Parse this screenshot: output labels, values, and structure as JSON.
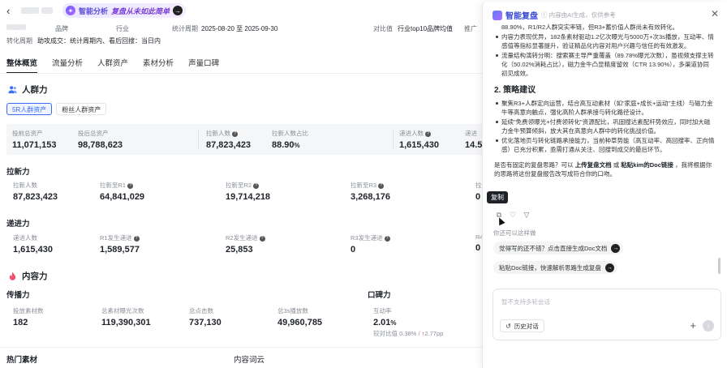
{
  "header": {
    "ai_pill_title": "智能分析",
    "ai_pill_slogan": "复盘从未如此简单"
  },
  "meta": {
    "brand_label": "品牌",
    "industry_label": "行业",
    "period_label": "统计周期",
    "period_value": "2025-08-20 至 2025-09-30",
    "compare_label": "对比值",
    "compare_value": "行业top10品牌均值",
    "promo_label": "推广",
    "conv_period_label": "转化周期",
    "conv_period_value": "助攻成交：统计周期内、看后回搜：当日内"
  },
  "tabs": [
    "整体概览",
    "流量分析",
    "人群资产",
    "素材分析",
    "声量口碑"
  ],
  "crowd": {
    "title": "人群力",
    "chips": [
      "5R人群资产",
      "粉丝人群资产"
    ],
    "summary": [
      {
        "label": "投前总资产",
        "value": "11,071,153"
      },
      {
        "label": "投后总资产",
        "value": "98,788,623"
      },
      {
        "label": "拉新人数",
        "value": "87,823,423"
      },
      {
        "label": "拉新人数占比",
        "value": "88.90",
        "unit": "%"
      },
      {
        "label": "递进人数",
        "value": "1,615,430"
      },
      {
        "label": "递进",
        "value": "14.5"
      }
    ],
    "pull_title": "拉新力",
    "pull": [
      {
        "label": "拉新人数",
        "value": "87,823,423"
      },
      {
        "label": "拉新至R1",
        "value": "64,841,029"
      },
      {
        "label": "拉新至R2",
        "value": "19,714,218"
      },
      {
        "label": "拉新至R3",
        "value": "3,268,176"
      },
      {
        "label": "拉",
        "value": "0"
      }
    ],
    "push_title": "递进力",
    "push": [
      {
        "label": "递进人数",
        "value": "1,615,430"
      },
      {
        "label": "R1发生递进",
        "value": "1,589,577"
      },
      {
        "label": "R2发生递进",
        "value": "25,853"
      },
      {
        "label": "R3发生递进",
        "value": "0"
      },
      {
        "label": "R4",
        "value": "0"
      }
    ]
  },
  "content": {
    "title": "内容力",
    "spread_title": "传播力",
    "word_title": "口碑力",
    "spread": [
      {
        "label": "投放素材数",
        "value": "182"
      },
      {
        "label": "总素材曝光次数",
        "value": "119,390,301"
      },
      {
        "label": "总点击数",
        "value": "737,130"
      },
      {
        "label": "总3s播放数",
        "value": "49,960,785"
      }
    ],
    "interaction": {
      "label": "互动率",
      "value": "2.01",
      "unit": "%",
      "compare": "较对比值 0.38%",
      "delta": "2.77pp"
    },
    "hot_title": "热门素材",
    "words_title": "内容词云"
  },
  "assistant": {
    "name": "智能复盘",
    "note": "内容由AI生成，仅供参考",
    "top_item": "88.90%，R1/R2人群突实率链，但R3+蓄价值人群尚未有效转化。",
    "items": [
      "内容力表现优异，182条素材驱动1.2亿次曝光与5000万+次3s播放，互动率、情感值等指标显著提升，验证精品化内容对用户兴趣与信任的有效激发。",
      "流量结构演转分明：搜索赛主导严重覆盖（89.78%曝光次数），虽视频支撑主转化（50.02%消耗占比），磁力金牛凸显精度留效（CTR 13.90%），多渠道协同初见成效。"
    ],
    "section_title": "2. 策略建议",
    "strategies": [
      "聚焦R3+人群定向运营，结合高互动素材（如\"家庭+成长+运动\"主线）与磁力金牛等高意向触点，强化高阶人群承接与转化路径设计。",
      "延续\"免费领曝光+付费领转化\"资源配比，巩固搜达素配杆势效应，同时加大磁力金牛预算倾斜，放大其在高意向人群中的转化挑战价值。",
      "优化落地页与转化链路承接能力，当前种草势能（高互动率、高回搜率、正向情感）已充分积累，亟需打通从关注、回搜到成交的最后环节。"
    ],
    "closing_prefix": "是否有固定的复盘思路？可以",
    "closing_link1": "上传复盘文档",
    "closing_mid": "或",
    "closing_link2": "粘贴kim的Doc链接",
    "closing_suffix": "，我将根据你的思路将这份复盘报告改写成符合你的口吻。",
    "copy_tooltip": "复制",
    "also_ask": "你还可以这样做",
    "suggestions": [
      "觉得写的还不错？点击直接生成Doc文档",
      "粘贴Doc链接，快速解析思路生成复盘"
    ],
    "input_placeholder": "暂不支持多轮会话",
    "history_label": "历史对话"
  }
}
